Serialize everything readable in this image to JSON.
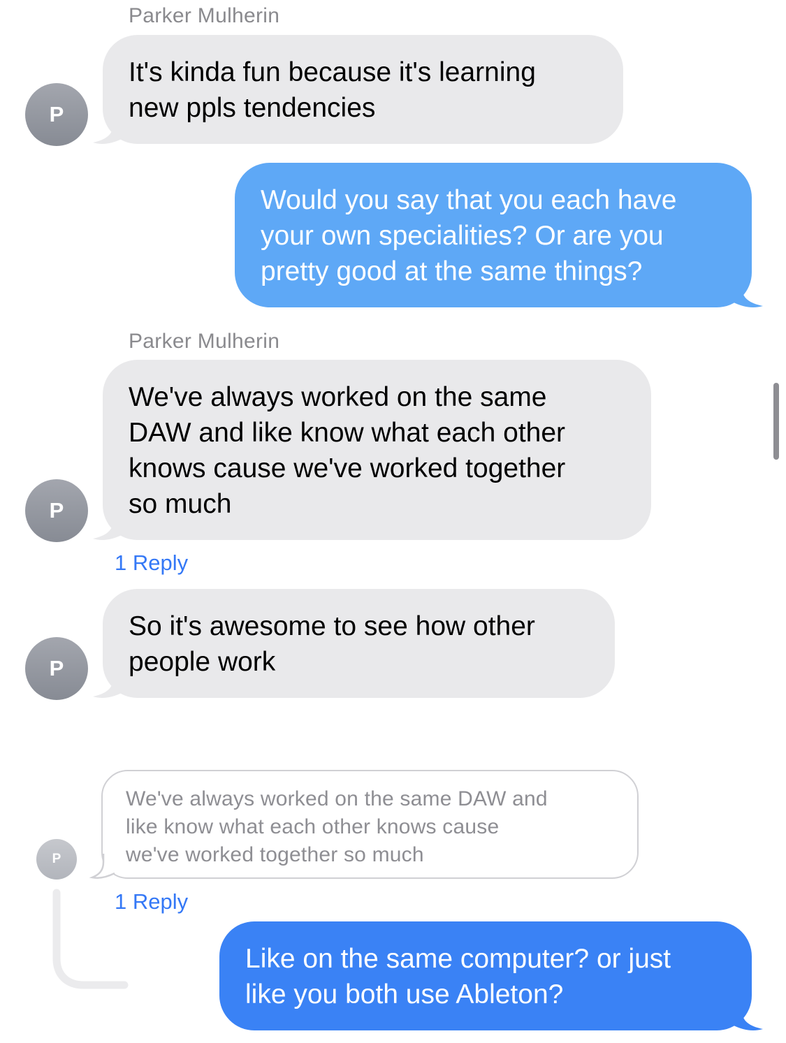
{
  "colors": {
    "incoming_bubble": "#e9e9eb",
    "outgoing_bubble_faded": "#5ea8f6",
    "outgoing_bubble_active": "#3a82f5",
    "link": "#3478f6",
    "secondary_text": "#8a8a8e"
  },
  "messages": [
    {
      "sender": "Parker Mulherin",
      "avatar_initial": "P",
      "lines": [
        "It's kinda fun because it's learning",
        "new ppls tendencies"
      ]
    },
    {
      "lines": [
        "Would you say that you each have",
        "your own specialities? Or are you",
        "pretty good at the same things?"
      ]
    },
    {
      "sender": "Parker Mulherin",
      "avatar_initial": "P",
      "lines": [
        "We've always worked on the same",
        "DAW and like know what each other",
        "knows cause we've worked together",
        "so much"
      ],
      "reply_count": "1 Reply"
    },
    {
      "avatar_initial": "P",
      "lines": [
        "So it's awesome to see how other",
        "people work"
      ]
    }
  ],
  "thread": {
    "avatar_initial": "P",
    "quoted_lines": [
      "We've always worked on the same DAW and",
      "like know what each other knows cause",
      "we've worked together so much"
    ],
    "reply_count": "1 Reply",
    "reply": {
      "lines": [
        "Like on the same computer? or just",
        "like you both use Ableton?"
      ]
    }
  },
  "icons": {
    "thread_connector": "thread-line",
    "scroll": "scrollbar"
  }
}
